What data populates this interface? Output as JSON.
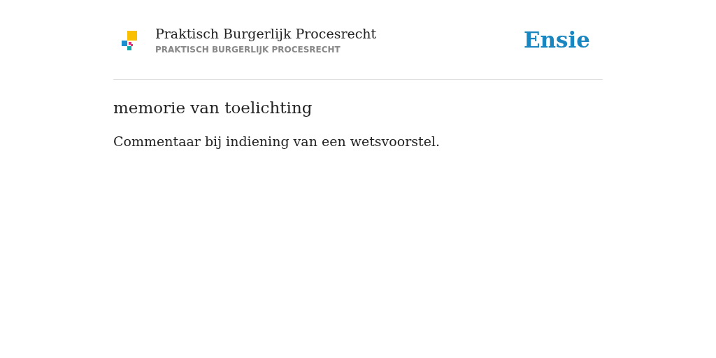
{
  "header": {
    "title": "Praktisch Burgerlijk Procesrecht",
    "subtitle": "PRAKTISCH BURGERLIJK PROCESRECHT",
    "brand": "Ensie"
  },
  "entry": {
    "term": "memorie van toelichting",
    "definition": "Commentaar bij indiening van een wetsvoorstel."
  }
}
